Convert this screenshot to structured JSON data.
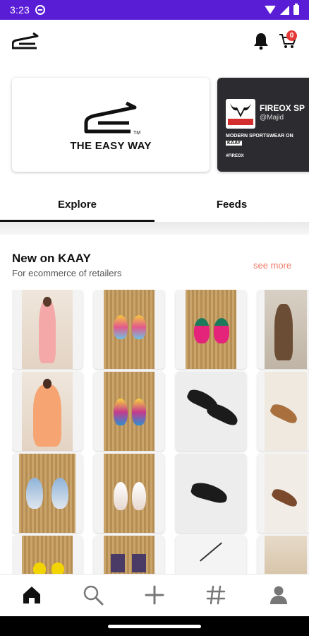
{
  "status_bar": {
    "time": "3:23",
    "color": "#5a1dd6"
  },
  "header": {
    "logo": "easy-way-logo-icon",
    "cart_count": "0",
    "badge_color": "#e53935"
  },
  "banners": [
    {
      "brand_text": "THE EASY WAY",
      "tm": "TM"
    },
    {
      "brand_name": "FIREOX SP",
      "handle": "@Majid",
      "tagline_pre": "MODERN SPORTSWEAR ON",
      "tagline_tag": "KAAY",
      "sub": "#FIREOX"
    }
  ],
  "tabs": [
    {
      "label": "Explore",
      "active": true
    },
    {
      "label": "Feeds",
      "active": false
    }
  ],
  "section": {
    "title": "New on KAAY",
    "subtitle": "For ecommerce of retailers",
    "see_more": "see more",
    "see_more_color": "#ee7a6a"
  },
  "products": [
    {
      "kind": "dress-pink"
    },
    {
      "kind": "earrings-colorful"
    },
    {
      "kind": "earrings-pink"
    },
    {
      "kind": "menswear"
    },
    {
      "kind": "dress-peach"
    },
    {
      "kind": "earrings-multicolor"
    },
    {
      "kind": "shoe-black"
    },
    {
      "kind": "sandal-tan"
    },
    {
      "kind": "earrings-blue"
    },
    {
      "kind": "earrings-lace"
    },
    {
      "kind": "sandal-black"
    },
    {
      "kind": "shoe-brown"
    },
    {
      "kind": "earrings-yellow"
    },
    {
      "kind": "earrings-portrait"
    },
    {
      "kind": "jewelry-silver"
    },
    {
      "kind": "fabric-tan"
    }
  ],
  "bottom_nav": [
    {
      "icon": "home-icon",
      "active": true
    },
    {
      "icon": "search-icon",
      "active": false
    },
    {
      "icon": "add-icon",
      "active": false
    },
    {
      "icon": "hashtag-icon",
      "active": false
    },
    {
      "icon": "profile-icon",
      "active": false
    }
  ]
}
